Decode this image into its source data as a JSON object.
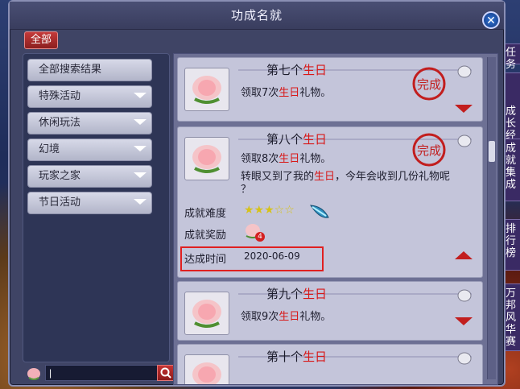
{
  "window": {
    "title": "功成名就",
    "close_label": "✕"
  },
  "filter_tab": {
    "label": "全部"
  },
  "categories": [
    {
      "label": "全部搜索结果",
      "has_chevron": false
    },
    {
      "label": "特殊活动",
      "has_chevron": true
    },
    {
      "label": "休闲玩法",
      "has_chevron": true
    },
    {
      "label": "幻境",
      "has_chevron": true
    },
    {
      "label": "玩家之家",
      "has_chevron": true
    },
    {
      "label": "节日活动",
      "has_chevron": true
    }
  ],
  "search": {
    "value": "|",
    "placeholder": ""
  },
  "side_tabs": [
    {
      "label": "任务"
    },
    {
      "label": "成长经历"
    },
    {
      "label": "成就集成"
    },
    {
      "label": "排行榜"
    },
    {
      "label": "万邦风华赛"
    }
  ],
  "achievements": [
    {
      "title_prefix": "第七个",
      "title_hl": "生日",
      "desc_prefix": "领取7次",
      "desc_hl": "生日",
      "desc_suffix": "礼物。",
      "completed": true,
      "seal_text": "完成",
      "expanded": false
    },
    {
      "title_prefix": "第八个",
      "title_hl": "生日",
      "desc_prefix": "领取8次",
      "desc_hl": "生日",
      "desc_suffix": "礼物。",
      "flavor_prefix": "转眼又到了我的",
      "flavor_hl": "生日",
      "flavor_suffix": "，今年会收到几份礼物呢",
      "flavor_line2": "？",
      "completed": true,
      "seal_text": "完成",
      "expanded": true,
      "difficulty_label": "成就难度",
      "difficulty_stars": "★★★☆☆",
      "reward_label": "成就奖励",
      "reward_count": "4",
      "time_label": "达成时间",
      "time_value": "2020-06-09"
    },
    {
      "title_prefix": "第九个",
      "title_hl": "生日",
      "desc_prefix": "领取9次",
      "desc_hl": "生日",
      "desc_suffix": "礼物。",
      "completed": false,
      "expanded": false
    },
    {
      "title_prefix": "第十个",
      "title_hl": "生日",
      "completed": false,
      "expanded": false
    }
  ],
  "colors": {
    "highlight": "#d81818",
    "seal": "#c21e1e"
  }
}
